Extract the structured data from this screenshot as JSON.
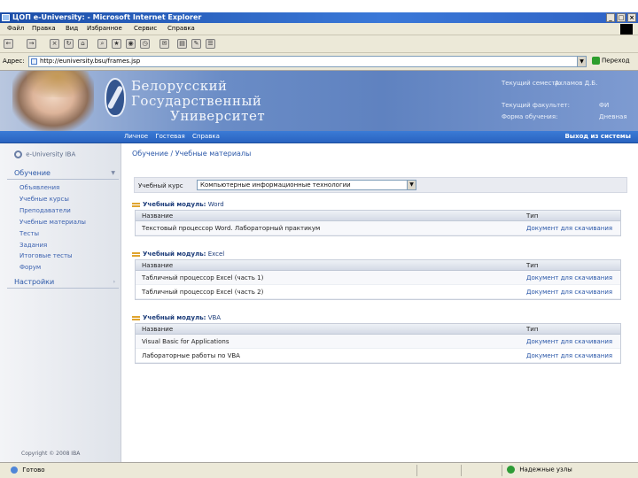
{
  "window": {
    "title": "ЦОП e-University: - Microsoft Internet Explorer",
    "min": "_",
    "max": "□",
    "close": "×"
  },
  "menu": [
    "Файл",
    "Правка",
    "Вид",
    "Избранное",
    "Сервис",
    "Справка"
  ],
  "address": {
    "label": "Адрес:",
    "url": "http://euniversity.bsu/frames.jsp",
    "go_label": "Переход"
  },
  "banner": {
    "university_lines": [
      "Белорусский",
      "Государственный",
      "Университет"
    ],
    "info_rows": [
      {
        "label": "Текущий семестр:",
        "value": "Ахламов Д.Б."
      },
      {
        "label": "Текущий факультет:",
        "value": "ФИ"
      },
      {
        "label": "Форма обучения:",
        "value": "Дневная"
      }
    ]
  },
  "nav": {
    "links": [
      "Личное",
      "Гостевая",
      "Справка"
    ],
    "exit": "Выход из системы"
  },
  "sidebar": {
    "brand": "e-University IBA",
    "section_main": "Обучение",
    "items": [
      "Объявления",
      "Учебные курсы",
      "Преподаватели",
      "Учебные материалы",
      "Тесты",
      "Задания",
      "Итоговые тесты",
      "Форум"
    ],
    "section_settings": "Настройки",
    "copyright": "Copyright © 2008 IBA"
  },
  "main": {
    "breadcrumb": "Обучение / Учебные материалы",
    "course_label": "Учебный курс",
    "course_value": "Компьютерные информационные технологии",
    "columns": {
      "name": "Название",
      "type": "Тип"
    },
    "modules": [
      {
        "label": "Учебный модуль:",
        "name": "Word",
        "rows": [
          {
            "name": "Текстовый процессор Word. Лабораторный практикум",
            "type": "Документ для скачивания"
          }
        ]
      },
      {
        "label": "Учебный модуль:",
        "name": "Excel",
        "rows": [
          {
            "name": "Табличный процессор Excel (часть 1)",
            "type": "Документ для скачивания"
          },
          {
            "name": "Табличный процессор Excel (часть 2)",
            "type": "Документ для скачивания"
          }
        ]
      },
      {
        "label": "Учебный модуль:",
        "name": "VBA",
        "rows": [
          {
            "name": "Visual Basic for Applications",
            "type": "Документ для скачивания"
          },
          {
            "name": "Лабораторные работы по VBA",
            "type": "Документ для скачивания"
          }
        ]
      }
    ]
  },
  "status": {
    "text": "Готово",
    "zone": "Надежные узлы"
  },
  "colors": {
    "titlebar": "#2f62c4",
    "nav_bar": "#2a63c0",
    "link_blue": "#2a57a8",
    "module_accent": "#e0a530"
  }
}
